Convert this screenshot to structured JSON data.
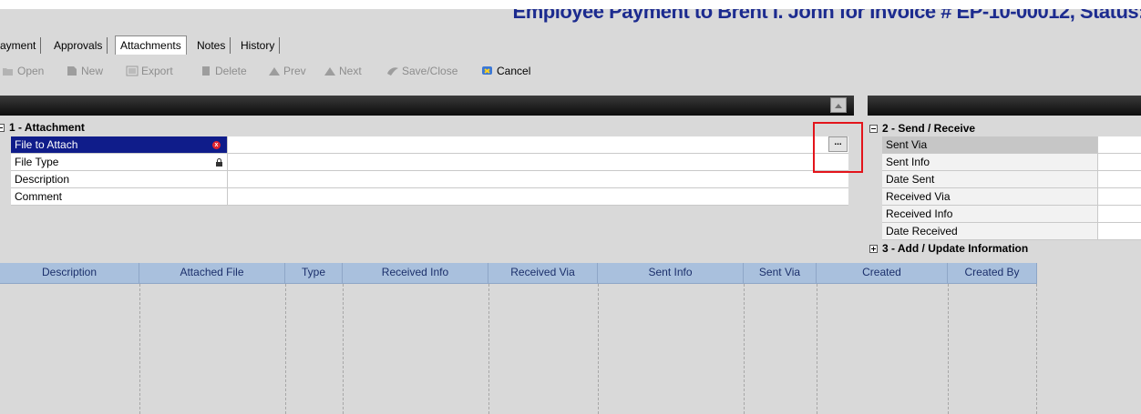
{
  "window": {
    "title": "Employee Payment to Brent I. John for Invoice # EP-10-00012, Status:"
  },
  "tabs": [
    {
      "label": "ayment",
      "active": false
    },
    {
      "label": "Approvals",
      "active": false
    },
    {
      "label": "Attachments",
      "active": true
    },
    {
      "label": "Notes",
      "active": false
    },
    {
      "label": "History",
      "active": false
    }
  ],
  "toolbar": {
    "open": "Open",
    "new": "New",
    "export": "Export",
    "delete": "Delete",
    "prev": "Prev",
    "next": "Next",
    "save_close": "Save/Close",
    "cancel": "Cancel"
  },
  "attachment_section": {
    "header": "1 - Attachment",
    "rows": [
      {
        "label": "File to Attach",
        "value": ""
      },
      {
        "label": "File Type",
        "value": ""
      },
      {
        "label": "Description",
        "value": ""
      },
      {
        "label": "Comment",
        "value": ""
      }
    ],
    "browse_label": "..."
  },
  "send_receive_section": {
    "header": "2 - Send / Receive",
    "rows": [
      {
        "label": "Sent Via",
        "value": ""
      },
      {
        "label": "Sent Info",
        "value": ""
      },
      {
        "label": "Date Sent",
        "value": ""
      },
      {
        "label": "Received Via",
        "value": ""
      },
      {
        "label": "Received Info",
        "value": ""
      },
      {
        "label": "Date Received",
        "value": ""
      }
    ]
  },
  "update_section": {
    "header": "3 - Add / Update Information"
  },
  "table": {
    "columns": [
      "Description",
      "Attached File",
      "Type",
      "Received Info",
      "Received Via",
      "Sent Info",
      "Sent Via",
      "Created",
      "Created By"
    ],
    "rows": []
  },
  "colors": {
    "title_text": "#1c2b8f",
    "selected_row": "#0f1c8a",
    "table_header": "#a9c0dd",
    "highlight": "#e3141b"
  }
}
